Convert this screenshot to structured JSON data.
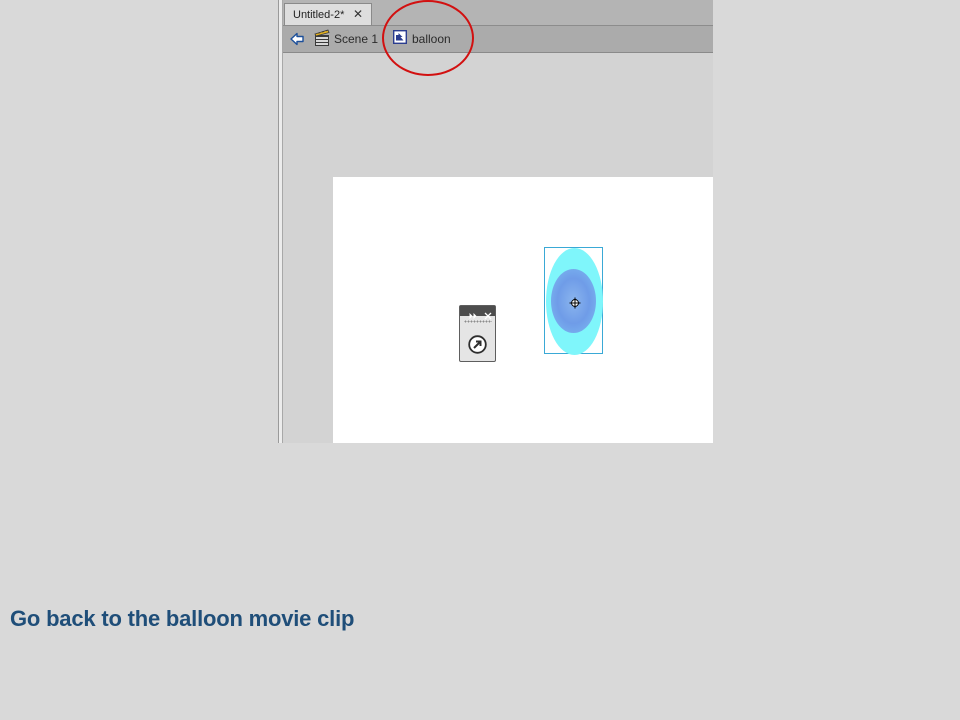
{
  "document_tab": {
    "label": "Untitled-2*",
    "close_symbol": "✕"
  },
  "edit_bar": {
    "back_icon": "back-arrow-icon",
    "scene_icon": "clapperboard-icon",
    "scene_label": "Scene 1",
    "movieclip_icon": "movie-clip-icon",
    "movieclip_label": "balloon"
  },
  "stage": {
    "background": "#ffffff",
    "balloon": {
      "outer_color": "#7ff6fb",
      "inner_color": "#6f9ce8",
      "bbox_color": "#3aa9d6"
    },
    "mini_panel_icons": [
      "expand-icon",
      "close-icon",
      "symbol-arrow-icon"
    ]
  },
  "annotation": {
    "color": "#d21010"
  },
  "instruction": {
    "text": "Go back to the balloon movie clip",
    "color": "#1f4e79"
  }
}
